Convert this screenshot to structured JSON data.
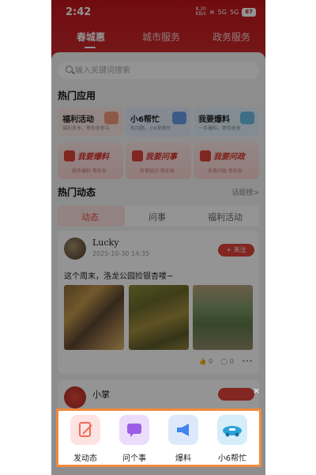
{
  "status_bar": {
    "time": "2:42",
    "net_speed": "8.20",
    "net_unit": "KB/s",
    "signal_1": "5G",
    "signal_2": "5G",
    "battery": "67"
  },
  "top_tabs": [
    {
      "label": "春城惠"
    },
    {
      "label": "城市服务"
    },
    {
      "label": "政务服务"
    }
  ],
  "search": {
    "placeholder": "输入关键词搜索"
  },
  "hot_apps": {
    "title": "热门应用",
    "items": [
      {
        "title": "福利活动",
        "sub": "福利多多，等你来参与"
      },
      {
        "title": "小6帮忙",
        "sub": "有问题，小6来帮忙"
      },
      {
        "title": "我要爆料",
        "sub": "一手爆料，等你来发"
      }
    ],
    "banners": [
      {
        "text": "我要爆料",
        "sub": "随手爆料 等你来"
      },
      {
        "text": "我要问事",
        "sub": "有事就问 等你来"
      },
      {
        "text": "我要问政",
        "sub": "有事问政 等你来"
      }
    ]
  },
  "hot_feed": {
    "title": "热门动态",
    "more": "话题榜>",
    "tabs": [
      {
        "label": "动态"
      },
      {
        "label": "问事"
      },
      {
        "label": "福利活动"
      }
    ]
  },
  "post": {
    "author": "Lucky",
    "time": "2025-10-30 14:35",
    "follow": "+ 关注",
    "text": "这个周末，洛龙公园捡银杏喽~",
    "likes": "0",
    "comments": "0",
    "more": "•••"
  },
  "post2": {
    "author": "小掌"
  },
  "close_label": "×",
  "sheet": {
    "items": [
      {
        "label": "发动态",
        "icon": "edit-icon",
        "color": "#f26a5a"
      },
      {
        "label": "问个事",
        "icon": "chat-icon",
        "color": "#9b5de5"
      },
      {
        "label": "爆料",
        "icon": "megaphone-icon",
        "color": "#3f86ee"
      },
      {
        "label": "小6帮忙",
        "icon": "robot-car-icon",
        "color": "#2aa3d8"
      }
    ]
  }
}
